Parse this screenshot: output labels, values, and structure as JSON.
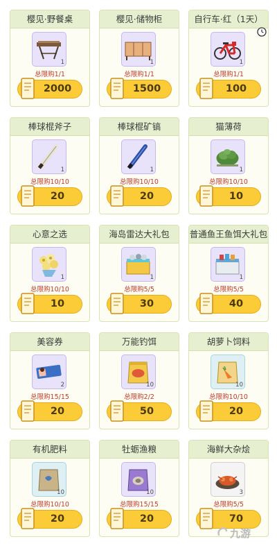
{
  "shop": {
    "items": [
      {
        "title": "樱见·野餐桌",
        "qty": "1",
        "limit": "总限购1/1",
        "price": "2000",
        "icon": "picnic-table-icon"
      },
      {
        "title": "樱见·储物柜",
        "qty": "1",
        "limit": "总限购1/1",
        "price": "1500",
        "icon": "storage-cabinet-icon"
      },
      {
        "title": "自行车·红（1天）",
        "qty": "1",
        "limit": "总限购1/1",
        "price": "100",
        "icon": "red-bicycle-icon",
        "timed": true
      },
      {
        "title": "棒球棍斧子",
        "qty": "1",
        "limit": "总限购10/10",
        "price": "20",
        "icon": "baseball-bat-axe-icon"
      },
      {
        "title": "棒球棍矿镐",
        "qty": "1",
        "limit": "总限购10/10",
        "price": "20",
        "icon": "baseball-bat-pickaxe-icon"
      },
      {
        "title": "猫薄荷",
        "qty": "1",
        "limit": "总限购10/10",
        "price": "10",
        "icon": "catnip-icon"
      },
      {
        "title": "心意之选",
        "qty": "1",
        "limit": "总限购10/10",
        "price": "10",
        "icon": "flower-bouquet-icon"
      },
      {
        "title": "海岛雷达大礼包",
        "qty": "1",
        "limit": "总限购5/5",
        "price": "30",
        "icon": "radar-gift-box-icon"
      },
      {
        "title": "普通鱼王鱼饵大礼包",
        "qty": "1",
        "limit": "总限购5/5",
        "price": "40",
        "icon": "bait-gift-box-icon"
      },
      {
        "title": "美容券",
        "qty": "2",
        "limit": "总限购15/15",
        "price": "20",
        "icon": "beauty-ticket-icon"
      },
      {
        "title": "万能钓饵",
        "qty": "10",
        "limit": "总限购2/2",
        "price": "50",
        "icon": "universal-bait-icon"
      },
      {
        "title": "胡萝卜饲料",
        "qty": "10",
        "limit": "总限购10/10",
        "price": "20",
        "icon": "carrot-feed-icon"
      },
      {
        "title": "有机肥料",
        "qty": "10",
        "limit": "总限购10/10",
        "price": "20",
        "icon": "organic-fertilizer-icon"
      },
      {
        "title": "牡蛎渔粮",
        "qty": "10",
        "limit": "总限购15/15",
        "price": "20",
        "icon": "oyster-feed-icon"
      },
      {
        "title": "海鲜大杂烩",
        "qty": "3",
        "limit": "总限购5/5",
        "price": "70",
        "icon": "seafood-platter-icon"
      }
    ]
  },
  "watermark": {
    "text": "九游"
  },
  "colors": {
    "card_bg": "#fdfdf3",
    "title_bg": "#e6efd0",
    "limit_text": "#c0392b",
    "price_pill": "#fbcb38",
    "item_frame": "#e9e2fb"
  }
}
